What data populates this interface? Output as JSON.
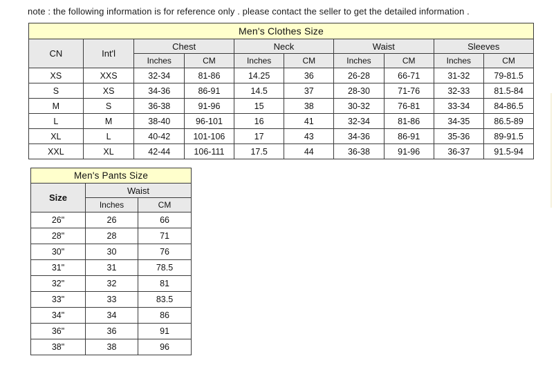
{
  "note": "note : the following information is for reference only . please contact the seller to get the detailed information .",
  "clothes_table": {
    "title": "Men's Clothes Size",
    "group_headers": [
      "CN",
      "Int'l",
      "Chest",
      "Neck",
      "Waist",
      "Sleeves"
    ],
    "sub_headers": [
      "",
      "",
      "Inches",
      "CM",
      "Inches",
      "CM",
      "Inches",
      "CM",
      "Inches",
      "CM"
    ],
    "rows": [
      [
        "XS",
        "XXS",
        "32-34",
        "81-86",
        "14.25",
        "36",
        "26-28",
        "66-71",
        "31-32",
        "79-81.5"
      ],
      [
        "S",
        "XS",
        "34-36",
        "86-91",
        "14.5",
        "37",
        "28-30",
        "71-76",
        "32-33",
        "81.5-84"
      ],
      [
        "M",
        "S",
        "36-38",
        "91-96",
        "15",
        "38",
        "30-32",
        "76-81",
        "33-34",
        "84-86.5"
      ],
      [
        "L",
        "M",
        "38-40",
        "96-101",
        "16",
        "41",
        "32-34",
        "81-86",
        "34-35",
        "86.5-89"
      ],
      [
        "XL",
        "L",
        "40-42",
        "101-106",
        "17",
        "43",
        "34-36",
        "86-91",
        "35-36",
        "89-91.5"
      ],
      [
        "XXL",
        "XL",
        "42-44",
        "106-111",
        "17.5",
        "44",
        "36-38",
        "91-96",
        "36-37",
        "91.5-94"
      ]
    ]
  },
  "pants_table": {
    "title": "Men's Pants Size",
    "size_header": "Size",
    "waist_header": "Waist",
    "sub_headers": [
      "Inches",
      "CM"
    ],
    "rows": [
      [
        "26\"",
        "26",
        "66"
      ],
      [
        "28\"",
        "28",
        "71"
      ],
      [
        "30\"",
        "30",
        "76"
      ],
      [
        "31\"",
        "31",
        "78.5"
      ],
      [
        "32\"",
        "32",
        "81"
      ],
      [
        "33\"",
        "33",
        "83.5"
      ],
      [
        "34\"",
        "34",
        "86"
      ],
      [
        "36\"",
        "36",
        "91"
      ],
      [
        "38\"",
        "38",
        "96"
      ]
    ]
  },
  "colors": {
    "title_background": "#ffffcc",
    "header_background": "#e9e9e9",
    "border": "#3a3a3a",
    "text": "#111111",
    "page_background": "#ffffff"
  }
}
